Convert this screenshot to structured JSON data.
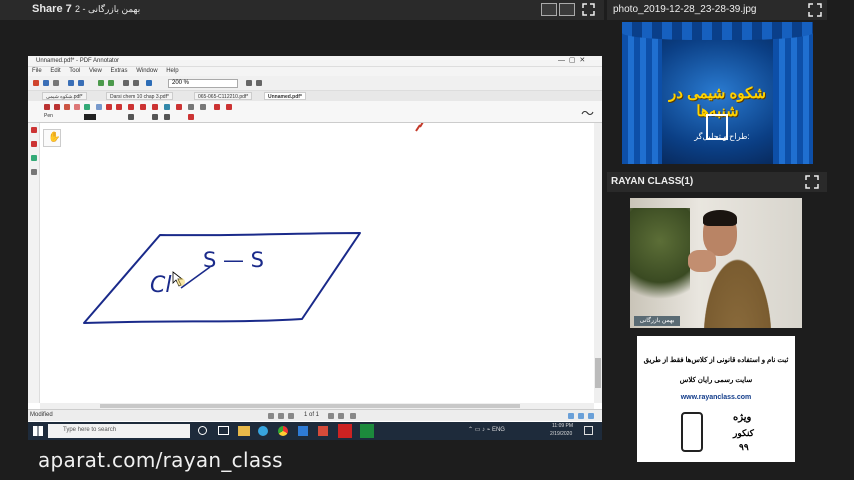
{
  "topbar": {
    "share_title": "Share 7",
    "presenter_name": "بهمن بازرگانی - 2"
  },
  "pdf": {
    "window_title": "Unnamed.pdf* - PDF Annotator",
    "menu": [
      "File",
      "Edit",
      "Tool",
      "View",
      "Extras",
      "Window",
      "Help"
    ],
    "zoom": "200 %",
    "tabs": [
      "شکوه شیمی.pdf*",
      "Darsi chem 10 chap 3.pdf*",
      "065-065-C112210.pdf*",
      "Unnamed.pdf*"
    ],
    "pen_label": "Pen",
    "status_left": "Modified",
    "page_indicator": "1 of 1",
    "drawing_labels": [
      "Cl",
      "S — S"
    ]
  },
  "taskbar": {
    "search_placeholder": "Type here to search",
    "time": "11:09 PM",
    "date": "2/19/2020"
  },
  "right_panel": {
    "photo_title": "photo_2019-12-28_23-28-39.jpg",
    "stage_headline": "شکوه شیمی در شنبه‌ها",
    "stage_sub": "طراح و تحلیل‌گر:",
    "class_title": "RAYAN CLASS",
    "class_count": "(1)",
    "video_caption": "بهمن بازرگانی",
    "ad_line1": "ثبت نام و استفاده قانونی از کلاس‌ها فقط از طریق",
    "ad_line2": "سایت رسمی رایان کلاس",
    "ad_url": "www.rayanclass.com",
    "ad_badge1": "ویژه",
    "ad_badge2": "کنکور",
    "ad_badge3": "۹۹"
  },
  "watermark": "aparat.com/rayan_class",
  "colors": {
    "drawing": "#1a2a8a",
    "panel_bg": "#2a2a2a"
  }
}
